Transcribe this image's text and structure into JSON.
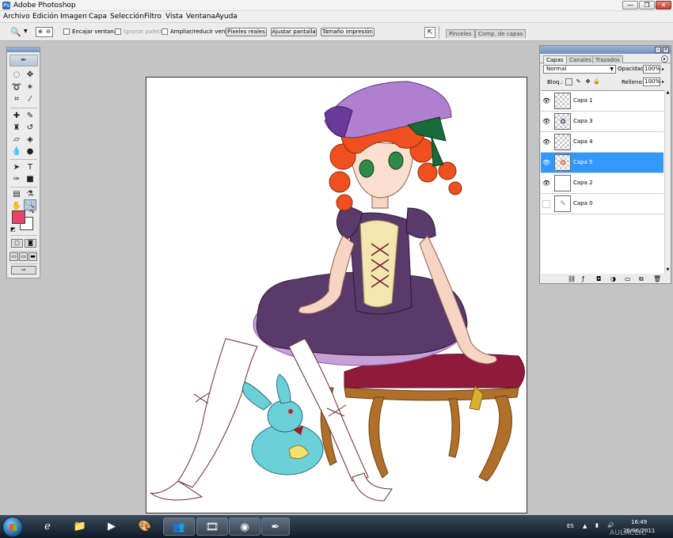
{
  "window": {
    "title": "Adobe Photoshop",
    "minimize": "—",
    "maximize": "❐",
    "close": "✕"
  },
  "menu": [
    "Archivo",
    "Edición",
    "Imagen",
    "Capa",
    "Selección",
    "Filtro",
    "Vista",
    "Ventana",
    "Ayuda"
  ],
  "options_bar": {
    "tool_icon": "zoom-icon",
    "checkboxes": [
      {
        "label": "Encajar ventana",
        "checked": false,
        "enabled": true
      },
      {
        "label": "Ignorar paletas",
        "checked": false,
        "enabled": false
      },
      {
        "label": "Ampliar/reducir vent.",
        "checked": false,
        "enabled": true
      }
    ],
    "buttons": [
      "Píxeles reales",
      "Ajustar pantalla",
      "Tamaño impresión"
    ],
    "dock_tabs": [
      "Pinceles",
      "Comp. de capas"
    ]
  },
  "toolbox": {
    "fg_color": "#e8436a",
    "bg_color": "#ffffff"
  },
  "layers_panel": {
    "tabs": [
      "Capas",
      "Canales",
      "Trazados"
    ],
    "active_tab": "Capas",
    "blend_mode": "Normal",
    "opacity_label": "Opacidad:",
    "opacity_value": "100%",
    "lock_label": "Bloq.:",
    "fill_label": "Relleno:",
    "fill_value": "100%",
    "layers": [
      {
        "name": "Capa 1",
        "visible": true,
        "selected": false
      },
      {
        "name": "Capa 3",
        "visible": true,
        "selected": false
      },
      {
        "name": "Capa 4",
        "visible": true,
        "selected": false
      },
      {
        "name": "Capa 5",
        "visible": true,
        "selected": true
      },
      {
        "name": "Capa 2",
        "visible": true,
        "selected": false
      },
      {
        "name": "Capa 0",
        "visible": false,
        "selected": false
      }
    ]
  },
  "taskbar": {
    "language": "ES",
    "time": "16:49",
    "date": "26/06/2011"
  },
  "watermark": "AULACLIC"
}
